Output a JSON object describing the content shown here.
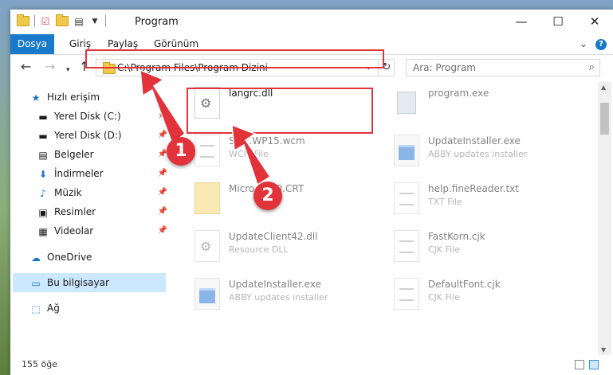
{
  "window": {
    "title": "Program",
    "controls": {
      "minimize": "—",
      "maximize": "☐",
      "close": "✕"
    }
  },
  "ribbon": {
    "tabs": [
      "Dosya",
      "Giriş",
      "Paylaş",
      "Görünüm"
    ]
  },
  "nav": {
    "address": "C:\\Program Files\\Program Dizini",
    "search_placeholder": "Ara: Program"
  },
  "sidebar": {
    "quick_access": "Hızlı erişim",
    "items": [
      {
        "label": "Yerel Disk (C:)",
        "icon": "drive-icon"
      },
      {
        "label": "Yerel Disk (D:)",
        "icon": "drive-icon"
      },
      {
        "label": "Belgeler",
        "icon": "documents-icon"
      },
      {
        "label": "İndirmeler",
        "icon": "download-icon"
      },
      {
        "label": "Müzik",
        "icon": "music-icon"
      },
      {
        "label": "Resimler",
        "icon": "pictures-icon"
      },
      {
        "label": "Videolar",
        "icon": "videos-icon"
      }
    ],
    "onedrive": "OneDrive",
    "this_pc": "Bu bilgisayar",
    "network": "Ağ"
  },
  "files": [
    {
      "name": "langrc.dll",
      "sub": "",
      "icon": "dll"
    },
    {
      "name": "program.exe",
      "sub": "",
      "icon": "prog"
    },
    {
      "name": "SM...WP15.wcm",
      "sub": "WCM File",
      "icon": "txt"
    },
    {
      "name": "UpdateInstaller.exe",
      "sub": "ABBY updates installer",
      "icon": "exe"
    },
    {
      "name": "Micro...C90.CRT",
      "sub": "",
      "icon": "folder"
    },
    {
      "name": "help.fineReader.txt",
      "sub": "TXT File",
      "icon": "txt"
    },
    {
      "name": "UpdateClient42.dll",
      "sub": "Resource DLL",
      "icon": "dll"
    },
    {
      "name": "FastKorn.cjk",
      "sub": "CJK File",
      "icon": "txt"
    },
    {
      "name": "UpdateInstaller.exe",
      "sub": "ABBY updates installer",
      "icon": "exe"
    },
    {
      "name": "DefaultFont.cjk",
      "sub": "CJK File",
      "icon": "txt"
    }
  ],
  "status": {
    "count": "155 öğe"
  },
  "annotations": {
    "step1": "1",
    "step2": "2",
    "color": "#e2323a"
  }
}
